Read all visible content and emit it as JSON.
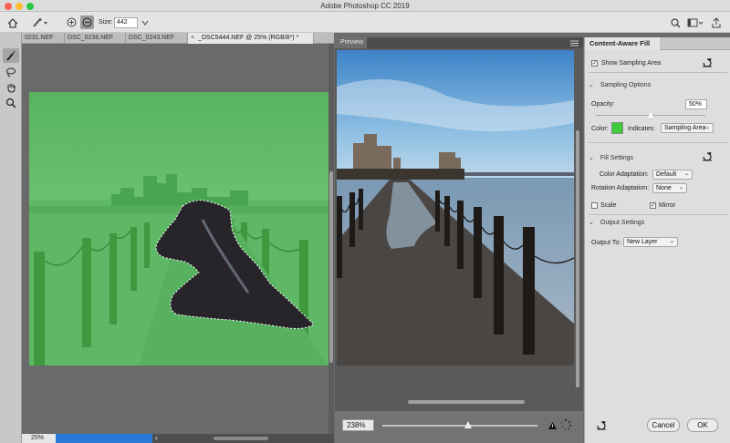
{
  "window": {
    "title": "Adobe Photoshop CC 2019"
  },
  "options": {
    "size_label": "Size:",
    "size_value": "442"
  },
  "tabs": [
    {
      "label": "0231.NEF"
    },
    {
      "label": "DSC_0236.NEF"
    },
    {
      "label": "DSC_0243.NEF"
    },
    {
      "label": "_DSC5444.NEF @ 25% (RGB/8*) *",
      "close": "×"
    }
  ],
  "status": {
    "zoom": "25%",
    "progress": 0.62
  },
  "preview": {
    "tab_label": "Preview",
    "zoom": "238%",
    "zoom_slider": 0.55
  },
  "panel": {
    "title": "Content-Aware Fill",
    "show_sampling_area": {
      "label": "Show Sampling Area",
      "checked": true
    },
    "sampling_options": {
      "title": "Sampling Options",
      "opacity_label": "Opacity:",
      "opacity_value": "50%",
      "opacity_fraction": 0.5,
      "color_label": "Color:",
      "color": "#3fcc3a",
      "indicates_label": "Indicates:",
      "indicates_value": "Sampling Area"
    },
    "fill_settings": {
      "title": "Fill Settings",
      "color_adaptation_label": "Color Adaptation:",
      "color_adaptation_value": "Default",
      "rotation_adaptation_label": "Rotation Adaptation:",
      "rotation_adaptation_value": "None",
      "scale_label": "Scale",
      "scale_checked": false,
      "mirror_label": "Mirror",
      "mirror_checked": true
    },
    "output_settings": {
      "title": "Output Settings",
      "output_to_label": "Output To:",
      "output_to_value": "New Layer"
    },
    "buttons": {
      "cancel": "Cancel",
      "ok": "OK"
    }
  },
  "colors": {
    "accent": "#2a79d8",
    "sampling_green": "#3fcc3a"
  }
}
